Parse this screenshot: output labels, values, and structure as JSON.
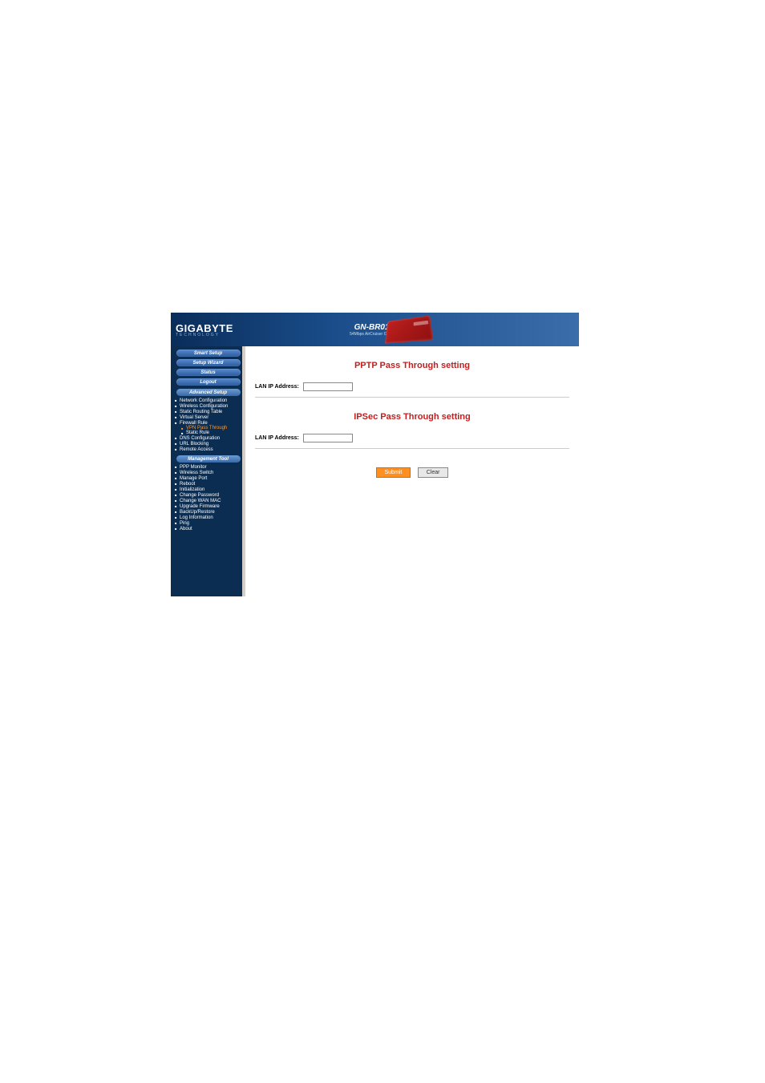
{
  "logo": {
    "brand": "GIGABYTE",
    "sub": "TECHNOLOGY"
  },
  "product": {
    "name": "GN-BR01G",
    "desc": "54Mbps AirCruiser G Router"
  },
  "sidebar": {
    "pill_buttons": [
      {
        "label": "Smart Setup"
      },
      {
        "label": "Setup Wizard"
      },
      {
        "label": "Status"
      },
      {
        "label": "Logout"
      }
    ],
    "sections": [
      {
        "header": "Advanced Setup",
        "items": [
          {
            "label": "Network Configuration"
          },
          {
            "label": "Wireless Configuration"
          },
          {
            "label": "Static Routing Table"
          },
          {
            "label": "Virtual Server"
          },
          {
            "label": "Firewall Rule",
            "sub": [
              {
                "label": "VPN Pass Through",
                "active": true
              },
              {
                "label": "Static Rule"
              }
            ]
          },
          {
            "label": "DNS Configuration"
          },
          {
            "label": "URL Blocking"
          },
          {
            "label": "Remote Access"
          }
        ]
      },
      {
        "header": "Management Tool",
        "items": [
          {
            "label": "PPP Monitor"
          },
          {
            "label": "Wireless Switch"
          },
          {
            "label": "Manage Port"
          },
          {
            "label": "Reboot"
          },
          {
            "label": "Initialization"
          },
          {
            "label": "Change Password"
          },
          {
            "label": "Change WAN MAC"
          },
          {
            "label": "Upgrade Firmware"
          },
          {
            "label": "BackUp/Restore"
          },
          {
            "label": "Log Information"
          },
          {
            "label": "Ping"
          },
          {
            "label": "About"
          }
        ]
      }
    ]
  },
  "content": {
    "section1_title": "PPTP Pass Through setting",
    "section2_title": "IPSec Pass Through setting",
    "lan_ip_label": "LAN IP Address:",
    "lan_ip_value1": "",
    "lan_ip_value2": "",
    "submit_label": "Submit",
    "clear_label": "Clear"
  }
}
